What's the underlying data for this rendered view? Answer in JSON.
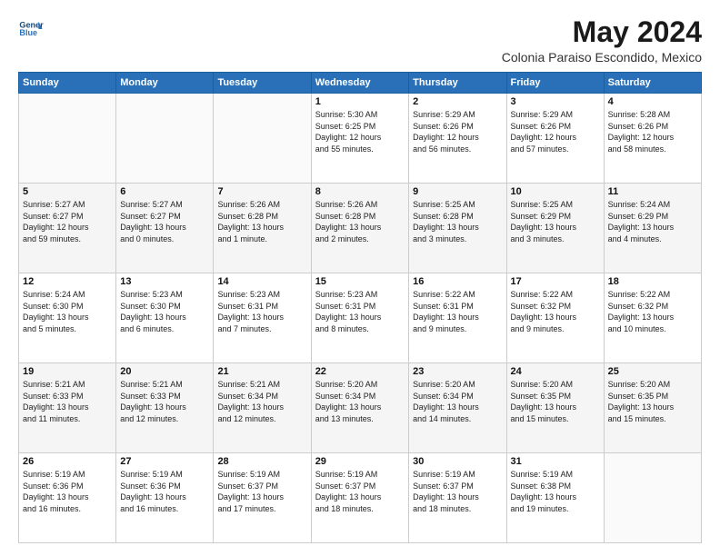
{
  "header": {
    "logo_line1": "General",
    "logo_line2": "Blue",
    "month_year": "May 2024",
    "location": "Colonia Paraiso Escondido, Mexico"
  },
  "weekdays": [
    "Sunday",
    "Monday",
    "Tuesday",
    "Wednesday",
    "Thursday",
    "Friday",
    "Saturday"
  ],
  "weeks": [
    [
      {
        "day": "",
        "info": ""
      },
      {
        "day": "",
        "info": ""
      },
      {
        "day": "",
        "info": ""
      },
      {
        "day": "1",
        "info": "Sunrise: 5:30 AM\nSunset: 6:25 PM\nDaylight: 12 hours\nand 55 minutes."
      },
      {
        "day": "2",
        "info": "Sunrise: 5:29 AM\nSunset: 6:26 PM\nDaylight: 12 hours\nand 56 minutes."
      },
      {
        "day": "3",
        "info": "Sunrise: 5:29 AM\nSunset: 6:26 PM\nDaylight: 12 hours\nand 57 minutes."
      },
      {
        "day": "4",
        "info": "Sunrise: 5:28 AM\nSunset: 6:26 PM\nDaylight: 12 hours\nand 58 minutes."
      }
    ],
    [
      {
        "day": "5",
        "info": "Sunrise: 5:27 AM\nSunset: 6:27 PM\nDaylight: 12 hours\nand 59 minutes."
      },
      {
        "day": "6",
        "info": "Sunrise: 5:27 AM\nSunset: 6:27 PM\nDaylight: 13 hours\nand 0 minutes."
      },
      {
        "day": "7",
        "info": "Sunrise: 5:26 AM\nSunset: 6:28 PM\nDaylight: 13 hours\nand 1 minute."
      },
      {
        "day": "8",
        "info": "Sunrise: 5:26 AM\nSunset: 6:28 PM\nDaylight: 13 hours\nand 2 minutes."
      },
      {
        "day": "9",
        "info": "Sunrise: 5:25 AM\nSunset: 6:28 PM\nDaylight: 13 hours\nand 3 minutes."
      },
      {
        "day": "10",
        "info": "Sunrise: 5:25 AM\nSunset: 6:29 PM\nDaylight: 13 hours\nand 3 minutes."
      },
      {
        "day": "11",
        "info": "Sunrise: 5:24 AM\nSunset: 6:29 PM\nDaylight: 13 hours\nand 4 minutes."
      }
    ],
    [
      {
        "day": "12",
        "info": "Sunrise: 5:24 AM\nSunset: 6:30 PM\nDaylight: 13 hours\nand 5 minutes."
      },
      {
        "day": "13",
        "info": "Sunrise: 5:23 AM\nSunset: 6:30 PM\nDaylight: 13 hours\nand 6 minutes."
      },
      {
        "day": "14",
        "info": "Sunrise: 5:23 AM\nSunset: 6:31 PM\nDaylight: 13 hours\nand 7 minutes."
      },
      {
        "day": "15",
        "info": "Sunrise: 5:23 AM\nSunset: 6:31 PM\nDaylight: 13 hours\nand 8 minutes."
      },
      {
        "day": "16",
        "info": "Sunrise: 5:22 AM\nSunset: 6:31 PM\nDaylight: 13 hours\nand 9 minutes."
      },
      {
        "day": "17",
        "info": "Sunrise: 5:22 AM\nSunset: 6:32 PM\nDaylight: 13 hours\nand 9 minutes."
      },
      {
        "day": "18",
        "info": "Sunrise: 5:22 AM\nSunset: 6:32 PM\nDaylight: 13 hours\nand 10 minutes."
      }
    ],
    [
      {
        "day": "19",
        "info": "Sunrise: 5:21 AM\nSunset: 6:33 PM\nDaylight: 13 hours\nand 11 minutes."
      },
      {
        "day": "20",
        "info": "Sunrise: 5:21 AM\nSunset: 6:33 PM\nDaylight: 13 hours\nand 12 minutes."
      },
      {
        "day": "21",
        "info": "Sunrise: 5:21 AM\nSunset: 6:34 PM\nDaylight: 13 hours\nand 12 minutes."
      },
      {
        "day": "22",
        "info": "Sunrise: 5:20 AM\nSunset: 6:34 PM\nDaylight: 13 hours\nand 13 minutes."
      },
      {
        "day": "23",
        "info": "Sunrise: 5:20 AM\nSunset: 6:34 PM\nDaylight: 13 hours\nand 14 minutes."
      },
      {
        "day": "24",
        "info": "Sunrise: 5:20 AM\nSunset: 6:35 PM\nDaylight: 13 hours\nand 15 minutes."
      },
      {
        "day": "25",
        "info": "Sunrise: 5:20 AM\nSunset: 6:35 PM\nDaylight: 13 hours\nand 15 minutes."
      }
    ],
    [
      {
        "day": "26",
        "info": "Sunrise: 5:19 AM\nSunset: 6:36 PM\nDaylight: 13 hours\nand 16 minutes."
      },
      {
        "day": "27",
        "info": "Sunrise: 5:19 AM\nSunset: 6:36 PM\nDaylight: 13 hours\nand 16 minutes."
      },
      {
        "day": "28",
        "info": "Sunrise: 5:19 AM\nSunset: 6:37 PM\nDaylight: 13 hours\nand 17 minutes."
      },
      {
        "day": "29",
        "info": "Sunrise: 5:19 AM\nSunset: 6:37 PM\nDaylight: 13 hours\nand 18 minutes."
      },
      {
        "day": "30",
        "info": "Sunrise: 5:19 AM\nSunset: 6:37 PM\nDaylight: 13 hours\nand 18 minutes."
      },
      {
        "day": "31",
        "info": "Sunrise: 5:19 AM\nSunset: 6:38 PM\nDaylight: 13 hours\nand 19 minutes."
      },
      {
        "day": "",
        "info": ""
      }
    ]
  ]
}
